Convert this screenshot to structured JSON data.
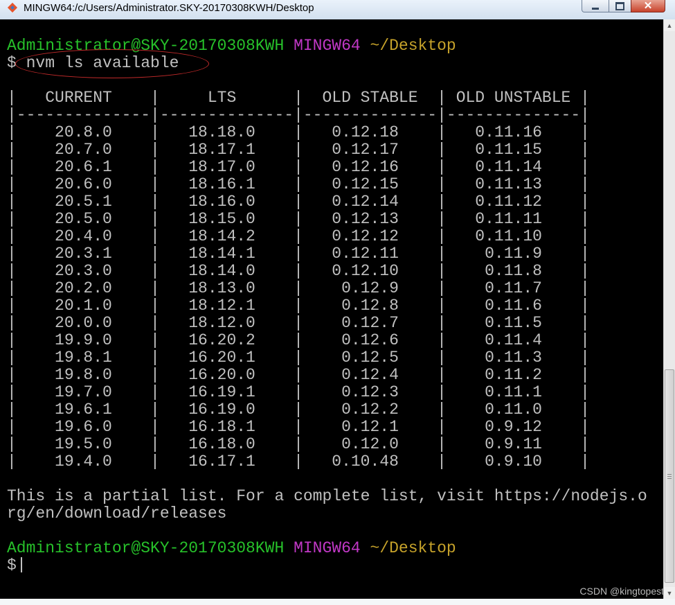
{
  "window": {
    "title": "MINGW64:/c/Users/Administrator.SKY-20170308KWH/Desktop",
    "app_icon": "git-bash-icon",
    "minimize_icon": "minimize-icon",
    "maximize_icon": "maximize-icon",
    "close_icon": "close-icon",
    "close_glyph": "✕"
  },
  "colors": {
    "user_host": "#27c12a",
    "shell": "#c138c6",
    "path": "#c6a22a",
    "text": "#c0c0c0",
    "background": "#000000",
    "annotation": "#c22a2a"
  },
  "prompt1": {
    "user_host": "Administrator@SKY-20170308KWH",
    "shell": "MINGW64",
    "path": "~/Desktop"
  },
  "command": "$ nvm ls available",
  "table_lines": [
    "|   CURRENT    |     LTS      |  OLD STABLE  | OLD UNSTABLE |",
    "|--------------|--------------|--------------|--------------|",
    "|    20.8.0    |   18.18.0    |   0.12.18    |   0.11.16    |",
    "|    20.7.0    |   18.17.1    |   0.12.17    |   0.11.15    |",
    "|    20.6.1    |   18.17.0    |   0.12.16    |   0.11.14    |",
    "|    20.6.0    |   18.16.1    |   0.12.15    |   0.11.13    |",
    "|    20.5.1    |   18.16.0    |   0.12.14    |   0.11.12    |",
    "|    20.5.0    |   18.15.0    |   0.12.13    |   0.11.11    |",
    "|    20.4.0    |   18.14.2    |   0.12.12    |   0.11.10    |",
    "|    20.3.1    |   18.14.1    |   0.12.11    |    0.11.9    |",
    "|    20.3.0    |   18.14.0    |   0.12.10    |    0.11.8    |",
    "|    20.2.0    |   18.13.0    |    0.12.9    |    0.11.7    |",
    "|    20.1.0    |   18.12.1    |    0.12.8    |    0.11.6    |",
    "|    20.0.0    |   18.12.0    |    0.12.7    |    0.11.5    |",
    "|    19.9.0    |   16.20.2    |    0.12.6    |    0.11.4    |",
    "|    19.8.1    |   16.20.1    |    0.12.5    |    0.11.3    |",
    "|    19.8.0    |   16.20.0    |    0.12.4    |    0.11.2    |",
    "|    19.7.0    |   16.19.1    |    0.12.3    |    0.11.1    |",
    "|    19.6.1    |   16.19.0    |    0.12.2    |    0.11.0    |",
    "|    19.6.0    |   16.18.1    |    0.12.1    |    0.9.12    |",
    "|    19.5.0    |   16.18.0    |    0.12.0    |    0.9.11    |",
    "|    19.4.0    |   16.17.1    |   0.10.48    |    0.9.10    |"
  ],
  "note_line1": "This is a partial list. For a complete list, visit https://nodejs.o",
  "note_line2": "rg/en/download/releases",
  "prompt2": {
    "user_host": "Administrator@SKY-20170308KWH",
    "shell": "MINGW64",
    "path": "~/Desktop"
  },
  "prompt_symbol": "$",
  "watermark": "CSDN @kingtopest"
}
